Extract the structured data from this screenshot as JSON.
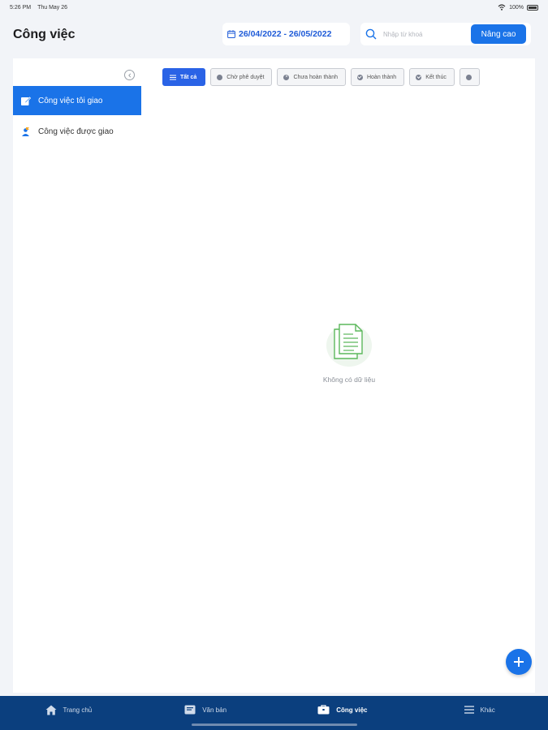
{
  "status_bar": {
    "time": "5:26 PM",
    "date": "Thu May 26",
    "battery": "100%"
  },
  "header": {
    "title": "Công việc",
    "date_range": "26/04/2022 - 26/05/2022",
    "search_placeholder": "Nhập từ khoá",
    "advanced_label": "Nâng cao"
  },
  "sidebar": {
    "items": [
      {
        "label": "Công việc tôi giao",
        "icon": "edit-task-icon",
        "active": true
      },
      {
        "label": "Công việc được giao",
        "icon": "assigned-user-icon",
        "active": false
      }
    ]
  },
  "filters": [
    {
      "label": "Tất cả",
      "icon": "list-icon",
      "active": true
    },
    {
      "label": "Chờ phê duyệt",
      "icon": "pending-icon",
      "active": false
    },
    {
      "label": "Chưa hoàn thành",
      "icon": "incomplete-icon",
      "active": false
    },
    {
      "label": "Hoàn thành",
      "icon": "check-icon",
      "active": false
    },
    {
      "label": "Kết thúc",
      "icon": "check-icon",
      "active": false
    },
    {
      "label": "",
      "icon": "more-icon",
      "active": false
    }
  ],
  "empty_state": {
    "text": "Không có dữ liệu",
    "icon": "documents-icon"
  },
  "tab_bar": [
    {
      "label": "Trang chủ",
      "icon": "home-icon",
      "active": false
    },
    {
      "label": "Văn bản",
      "icon": "document-icon",
      "active": false
    },
    {
      "label": "Công việc",
      "icon": "briefcase-icon",
      "active": true
    },
    {
      "label": "Khác",
      "icon": "menu-icon",
      "active": false
    }
  ],
  "colors": {
    "primary": "#1a73e8",
    "tab_bar": "#0b3f7e",
    "empty_icon": "#5cb85c"
  }
}
